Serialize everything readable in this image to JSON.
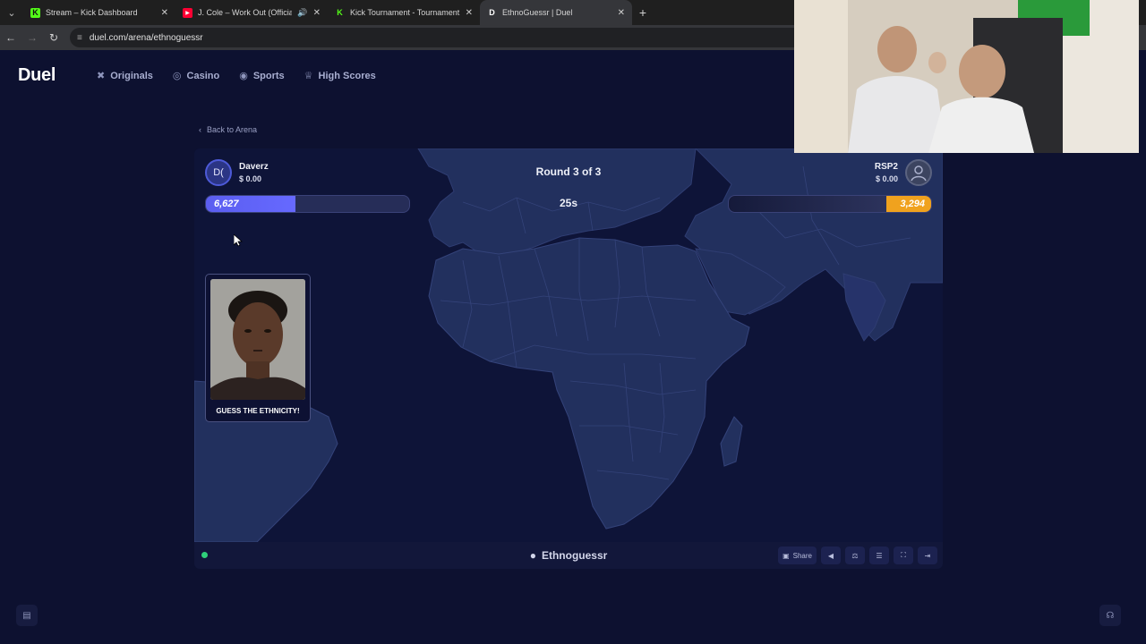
{
  "browser": {
    "tabs": [
      {
        "title": "Stream – Kick Dashboard",
        "favicon": "kick-icon",
        "favicon_color": "#53fc18",
        "audio": false,
        "active": false
      },
      {
        "title": "J. Cole – Work Out (Official",
        "favicon": "youtube-icon",
        "favicon_color": "#ff0033",
        "audio": true,
        "active": false
      },
      {
        "title": "Kick Tournament - Tournament",
        "favicon": "kick-icon",
        "favicon_color": "#53fc18",
        "audio": false,
        "active": false
      },
      {
        "title": "EthnoGuessr | Duel",
        "favicon": "duel-icon",
        "favicon_color": "#ffffff",
        "audio": false,
        "active": true
      }
    ],
    "url": "duel.com/arena/ethnoguessr"
  },
  "site": {
    "brand": "Duel",
    "nav": [
      {
        "label": "Originals",
        "icon": "originals-icon"
      },
      {
        "label": "Casino",
        "icon": "casino-icon"
      },
      {
        "label": "Sports",
        "icon": "sports-icon"
      },
      {
        "label": "High Scores",
        "icon": "trophy-icon"
      }
    ],
    "back_label": "Back to Arena"
  },
  "game": {
    "round_label": "Round 3 of 3",
    "timer": "25s",
    "player_left": {
      "initials": "D(",
      "name": "Daverz",
      "balance": "$ 0.00",
      "score": "6,627",
      "bar_fraction": 0.44,
      "color": "#5b5ef0"
    },
    "player_right": {
      "name": "RSP2",
      "balance": "$ 0.00",
      "score": "3,294",
      "bar_fraction": 0.22,
      "color": "#f0a21e"
    },
    "card_caption": "GUESS THE ETHNICITY!",
    "game_name": "Ethnoguessr",
    "tools": [
      {
        "name": "share-button",
        "label": "Share",
        "icon": "share-icon"
      },
      {
        "name": "sound-button",
        "label": "",
        "icon": "speaker-icon"
      },
      {
        "name": "fairness-button",
        "label": "",
        "icon": "scale-icon"
      },
      {
        "name": "rules-button",
        "label": "",
        "icon": "book-icon"
      },
      {
        "name": "fullscreen-button",
        "label": "",
        "icon": "fullscreen-icon"
      },
      {
        "name": "exit-button",
        "label": "",
        "icon": "exit-icon"
      }
    ]
  },
  "colors": {
    "background": "#0d1130",
    "map_land": "#22305e",
    "map_sea": "#0e1438",
    "status_online": "#2fd07a"
  }
}
